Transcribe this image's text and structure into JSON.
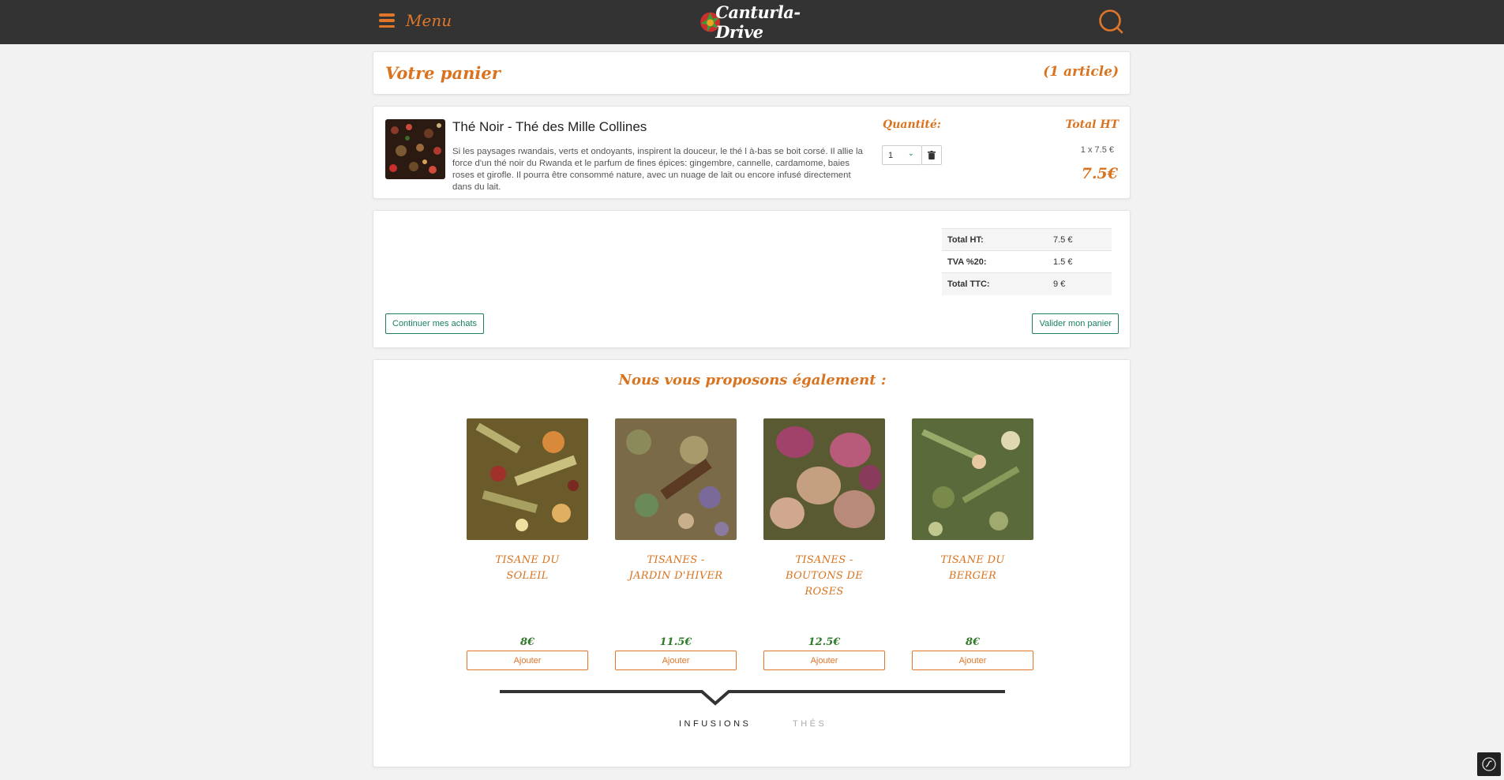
{
  "header": {
    "menu_label": "Menu",
    "logo_text": "Canturla-Drive"
  },
  "cart": {
    "title": "Votre panier",
    "count": "(1 article)",
    "item": {
      "name": "Thé Noir - Thé des Mille Collines",
      "description": "Si les paysages rwandais, verts et ondoyants, inspirent la douceur, le thé l à-bas se boit corsé. Il allie la force d'un thé noir du Rwanda et le parfum de fines épices: gingembre, cannelle, cardamome, baies roses et girofle. Il pourra être consommé nature, avec un nuage de lait ou encore infusé directement dans du lait.",
      "quantity_label": "Quantité:",
      "quantity": "1",
      "total_label": "Total HT",
      "unit_line": "1 x 7.5 €",
      "total": "7.5€"
    }
  },
  "totals": {
    "rows": [
      {
        "label": "Total HT:",
        "value": "7.5 €"
      },
      {
        "label": "TVA %20:",
        "value": "1.5 €"
      },
      {
        "label": "Total TTC:",
        "value": "9 €"
      }
    ],
    "continue_label": "Continuer mes achats",
    "validate_label": "Valider mon panier"
  },
  "suggestions": {
    "title": "Nous vous proposons également :",
    "products": [
      {
        "name": "Tisane du Soleil",
        "price": "8€",
        "add_label": "Ajouter"
      },
      {
        "name": "Tisanes - Jardin d'Hiver",
        "price": "11.5€",
        "add_label": "Ajouter"
      },
      {
        "name": "Tisanes - Boutons de roses",
        "price": "12.5€",
        "add_label": "Ajouter"
      },
      {
        "name": "Tisane du Berger",
        "price": "8€",
        "add_label": "Ajouter"
      }
    ],
    "tabs": [
      "INFUSIONS",
      "THÉS"
    ]
  }
}
